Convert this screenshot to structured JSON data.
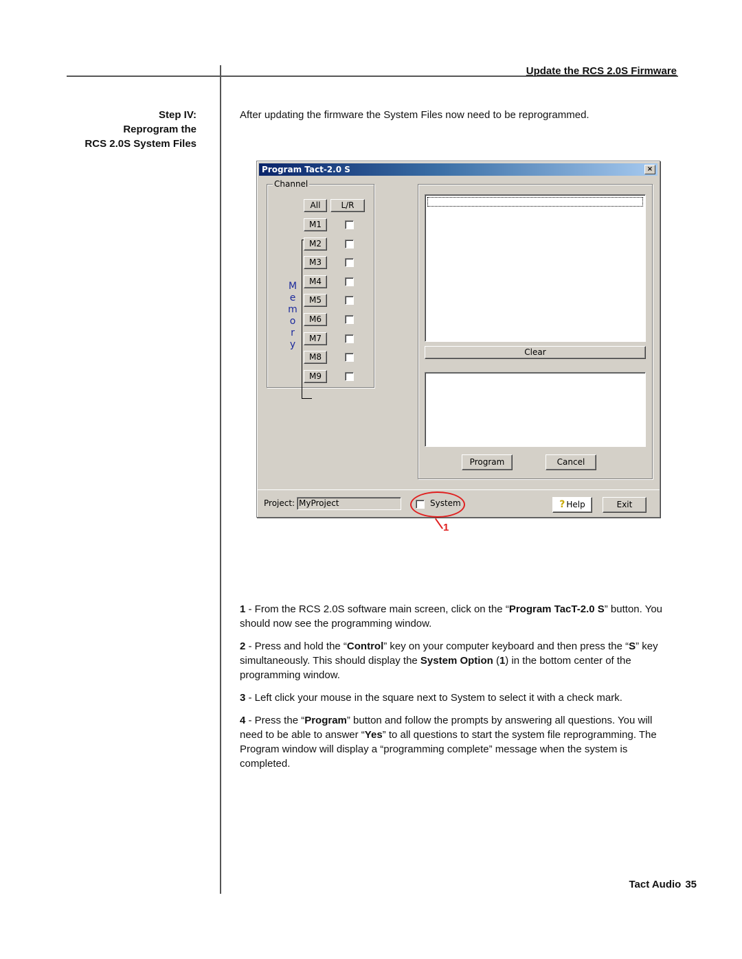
{
  "page": {
    "header_title": "Update the RCS 2.0S Firmware",
    "side_title": [
      "Step IV:",
      "Reprogram the",
      "RCS 2.0S System Files"
    ],
    "intro": "After updating the firmware the System Files now need to be reprogrammed.",
    "steps": [
      {
        "num": "1",
        "parts": [
          " - From the RCS 2.0S software main screen, click on the “",
          {
            "b": "Program TacT-2.0 S"
          },
          "” button. You should now see the programming window."
        ]
      },
      {
        "num": "2",
        "parts": [
          " - Press and hold the “",
          {
            "b": "Control"
          },
          "” key on your computer keyboard and then press the “",
          {
            "b": "S"
          },
          "” key simultaneously.  This should display the ",
          {
            "b": "System Option"
          },
          " (",
          {
            "b": "1"
          },
          ") in the bottom center of the programming window."
        ]
      },
      {
        "num": "3",
        "parts": [
          " - Left click your mouse in the square next to System to select it with a check mark."
        ]
      },
      {
        "num": "4",
        "parts": [
          " - Press the “",
          {
            "b": "Program"
          },
          "” button and follow the prompts by answering all questions.  You will need to be able to answer “",
          {
            "b": "Yes"
          },
          "” to all questions to start the system file reprogramming. The Program window will display a “programming complete” message when the system is completed."
        ]
      }
    ],
    "footer": {
      "brand": "Tact Audio",
      "page_number": "35"
    },
    "callout_number": "1",
    "callout_color": "#e02020"
  },
  "window": {
    "title": "Program Tact-2.0 S",
    "close_glyph": "×",
    "channel_group_label": "Channel",
    "all_label": "All",
    "lr_label": "L/R",
    "memory_label": [
      "M",
      "e",
      "m",
      "o",
      "r",
      "y"
    ],
    "memories": [
      {
        "label": "M1",
        "checked": false
      },
      {
        "label": "M2",
        "checked": false
      },
      {
        "label": "M3",
        "checked": false
      },
      {
        "label": "M4",
        "checked": false
      },
      {
        "label": "M5",
        "checked": false
      },
      {
        "label": "M6",
        "checked": false
      },
      {
        "label": "M7",
        "checked": false
      },
      {
        "label": "M8",
        "checked": false
      },
      {
        "label": "M9",
        "checked": false
      }
    ],
    "clear_label": "Clear",
    "program_label": "Program",
    "cancel_label": "Cancel",
    "project_label": "Project:",
    "project_value": "MyProject",
    "system_label": "System",
    "system_checked": false,
    "help_icon_glyph": "?",
    "help_label": "Help",
    "exit_label": "Exit"
  }
}
